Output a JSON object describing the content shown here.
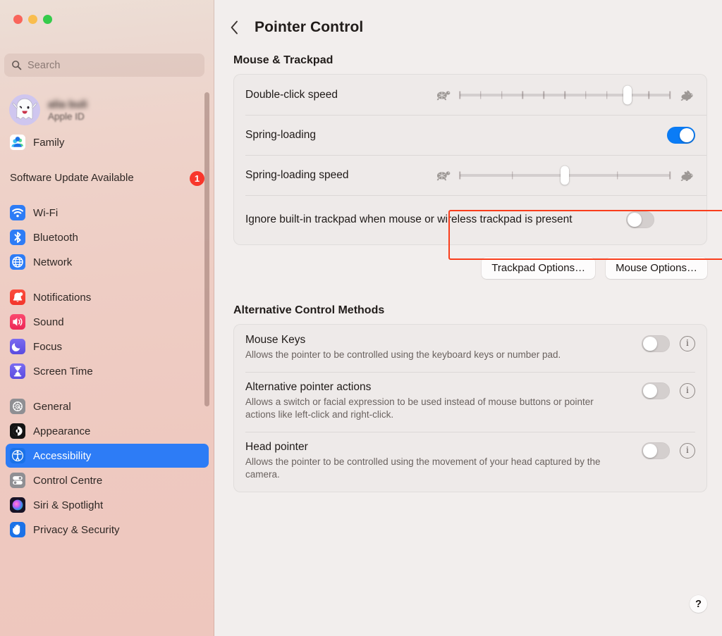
{
  "window": {
    "traffic_lights": [
      "close",
      "minimize",
      "zoom"
    ],
    "colors": {
      "close": "#f9655b",
      "minimize": "#f9bd4e",
      "zoom": "#35cb4b",
      "accent_blue": "#2d7cf6",
      "toggle_on": "#0a7cf6",
      "badge_red": "#f8362b",
      "highlight_red": "#f93d1c"
    }
  },
  "sidebar": {
    "search": {
      "placeholder": "Search",
      "icon": "search-icon",
      "value": ""
    },
    "account": {
      "name": "alia buli",
      "subtitle": "Apple ID",
      "avatar_icon": "ghost-avatar-icon"
    },
    "family": {
      "label": "Family",
      "icon": "family-icon"
    },
    "software_update": {
      "label": "Software Update Available",
      "badge": "1"
    },
    "groups": [
      {
        "items": [
          {
            "label": "Wi-Fi",
            "icon": "wifi-icon"
          },
          {
            "label": "Bluetooth",
            "icon": "bluetooth-icon"
          },
          {
            "label": "Network",
            "icon": "network-icon"
          }
        ]
      },
      {
        "items": [
          {
            "label": "Notifications",
            "icon": "notifications-icon"
          },
          {
            "label": "Sound",
            "icon": "sound-icon"
          },
          {
            "label": "Focus",
            "icon": "focus-icon"
          },
          {
            "label": "Screen Time",
            "icon": "screen-time-icon"
          }
        ]
      },
      {
        "items": [
          {
            "label": "General",
            "icon": "general-icon"
          },
          {
            "label": "Appearance",
            "icon": "appearance-icon"
          },
          {
            "label": "Accessibility",
            "icon": "accessibility-icon",
            "selected": true
          },
          {
            "label": "Control Centre",
            "icon": "control-centre-icon"
          },
          {
            "label": "Siri & Spotlight",
            "icon": "siri-icon"
          },
          {
            "label": "Privacy & Security",
            "icon": "privacy-icon"
          }
        ]
      }
    ]
  },
  "main": {
    "back_icon": "chevron-left-icon",
    "title": "Pointer Control",
    "sections": [
      {
        "heading": "Mouse & Trackpad",
        "rows": [
          {
            "label": "Double-click speed",
            "control": "slider",
            "ticks": 11,
            "value": 9,
            "min_icon": "turtle-icon",
            "max_icon": "rabbit-icon"
          },
          {
            "label": "Spring-loading",
            "control": "toggle",
            "value": "on"
          },
          {
            "label": "Spring-loading speed",
            "control": "slider",
            "ticks": 5,
            "value": 3,
            "min_icon": "turtle-icon",
            "max_icon": "rabbit-icon"
          },
          {
            "label": "Ignore built-in trackpad when mouse or wireless trackpad is present",
            "control": "toggle",
            "value": "off",
            "highlighted": true
          }
        ]
      }
    ],
    "buttons": [
      {
        "label": "Trackpad Options…"
      },
      {
        "label": "Mouse Options…"
      }
    ],
    "alternative": {
      "heading": "Alternative Control Methods",
      "rows": [
        {
          "title": "Mouse Keys",
          "description": "Allows the pointer to be controlled using the keyboard keys or number pad.",
          "toggle": "off",
          "info_icon": "info-icon"
        },
        {
          "title": "Alternative pointer actions",
          "description": "Allows a switch or facial expression to be used instead of mouse buttons or pointer actions like left-click and right-click.",
          "toggle": "off",
          "info_icon": "info-icon"
        },
        {
          "title": "Head pointer",
          "description": "Allows the pointer to be controlled using the movement of your head captured by the camera.",
          "toggle": "off",
          "info_icon": "info-icon"
        }
      ]
    },
    "help": {
      "label": "?",
      "icon": "help-icon"
    }
  }
}
